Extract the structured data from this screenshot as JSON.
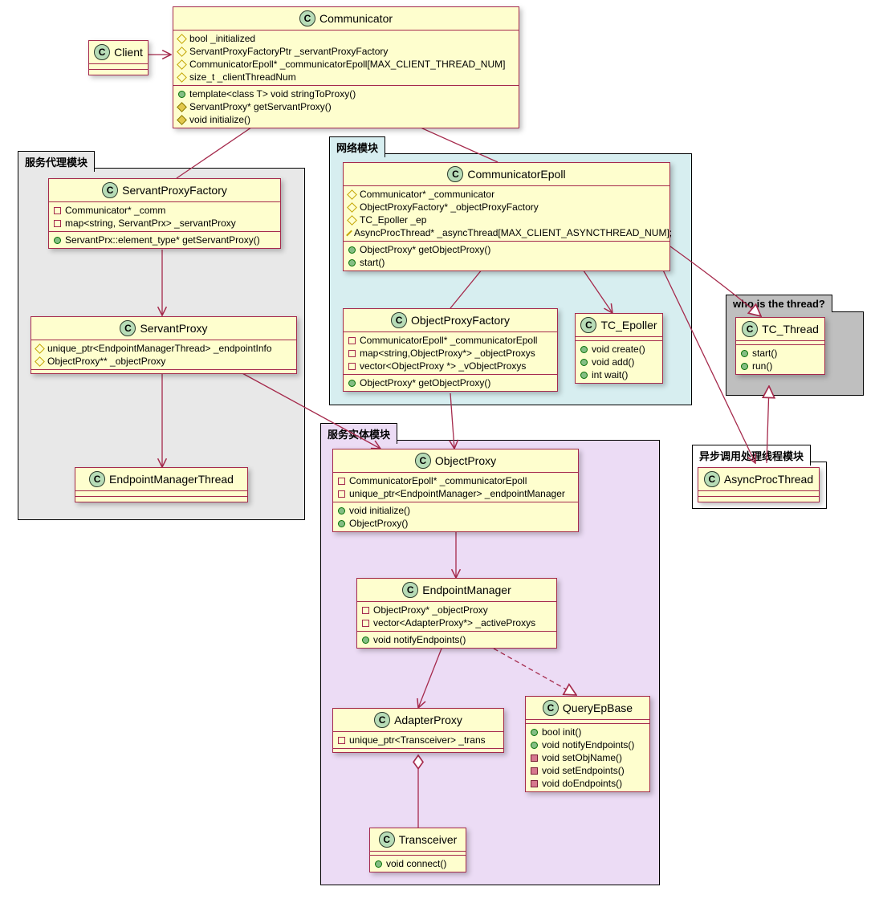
{
  "packages": {
    "proxy": {
      "title": "服务代理模块"
    },
    "net": {
      "title": "网络模块"
    },
    "entity": {
      "title": "服务实体模块"
    },
    "thread": {
      "title": "who is the thread?"
    },
    "async": {
      "title": "异步调用处理线程模块"
    }
  },
  "classes": {
    "Client": {
      "name": "Client"
    },
    "Communicator": {
      "name": "Communicator",
      "fields": [
        {
          "vis": "prot-o",
          "text": "bool _initialized"
        },
        {
          "vis": "prot-o",
          "text": "ServantProxyFactoryPtr _servantProxyFactory"
        },
        {
          "vis": "prot-o",
          "text": "CommunicatorEpoll* _communicatorEpoll[MAX_CLIENT_THREAD_NUM]"
        },
        {
          "vis": "prot-o",
          "text": "size_t _clientThreadNum"
        }
      ],
      "methods": [
        {
          "vis": "pub",
          "text": "template<class T> void stringToProxy()"
        },
        {
          "vis": "prot-f",
          "text": "ServantProxy* getServantProxy()"
        },
        {
          "vis": "prot-f",
          "text": "void initialize()"
        }
      ]
    },
    "ServantProxyFactory": {
      "name": "ServantProxyFactory",
      "fields": [
        {
          "vis": "priv-o",
          "text": "Communicator* _comm"
        },
        {
          "vis": "priv-o",
          "text": "map<string, ServantPrx> _servantProxy"
        }
      ],
      "methods": [
        {
          "vis": "pub",
          "text": "ServantPrx::element_type* getServantProxy()"
        }
      ]
    },
    "ServantProxy": {
      "name": "ServantProxy",
      "fields": [
        {
          "vis": "prot-o",
          "text": "unique_ptr<EndpointManagerThread> _endpointInfo"
        },
        {
          "vis": "prot-o",
          "text": "ObjectProxy** _objectProxy"
        }
      ]
    },
    "EndpointManagerThread": {
      "name": "EndpointManagerThread"
    },
    "CommunicatorEpoll": {
      "name": "CommunicatorEpoll",
      "fields": [
        {
          "vis": "prot-o",
          "text": "Communicator* _communicator"
        },
        {
          "vis": "prot-o",
          "text": "ObjectProxyFactory* _objectProxyFactory"
        },
        {
          "vis": "prot-o",
          "text": "TC_Epoller _ep"
        },
        {
          "vis": "prot-o",
          "text": "AsyncProcThread* _asyncThread[MAX_CLIENT_ASYNCTHREAD_NUM];"
        }
      ],
      "methods": [
        {
          "vis": "pub",
          "text": "ObjectProxy* getObjectProxy()"
        },
        {
          "vis": "pub",
          "text": "start()"
        }
      ]
    },
    "ObjectProxyFactory": {
      "name": "ObjectProxyFactory",
      "fields": [
        {
          "vis": "priv-o",
          "text": "CommunicatorEpoll* _communicatorEpoll"
        },
        {
          "vis": "priv-o",
          "text": "map<string,ObjectProxy*> _objectProxys"
        },
        {
          "vis": "priv-o",
          "text": "vector<ObjectProxy *> _vObjectProxys"
        }
      ],
      "methods": [
        {
          "vis": "pub",
          "text": "ObjectProxy* getObjectProxy()"
        }
      ]
    },
    "TC_Epoller": {
      "name": "TC_Epoller",
      "methods": [
        {
          "vis": "pub",
          "text": "void create()"
        },
        {
          "vis": "pub",
          "text": "void add()"
        },
        {
          "vis": "pub",
          "text": "int wait()"
        }
      ]
    },
    "TC_Thread": {
      "name": "TC_Thread",
      "methods": [
        {
          "vis": "pub",
          "text": "start()"
        },
        {
          "vis": "pub",
          "text": "run()"
        }
      ]
    },
    "AsyncProcThread": {
      "name": "AsyncProcThread"
    },
    "ObjectProxy": {
      "name": "ObjectProxy",
      "fields": [
        {
          "vis": "priv-o",
          "text": "CommunicatorEpoll* _communicatorEpoll"
        },
        {
          "vis": "priv-o",
          "text": "unique_ptr<EndpointManager> _endpointManager"
        }
      ],
      "methods": [
        {
          "vis": "pub",
          "text": "void initialize()"
        },
        {
          "vis": "pub",
          "text": "ObjectProxy()"
        }
      ]
    },
    "EndpointManager": {
      "name": "EndpointManager",
      "fields": [
        {
          "vis": "priv-o",
          "text": "ObjectProxy* _objectProxy"
        },
        {
          "vis": "priv-o",
          "text": "vector<AdapterProxy*> _activeProxys"
        }
      ],
      "methods": [
        {
          "vis": "pub",
          "text": "void notifyEndpoints()"
        }
      ]
    },
    "QueryEpBase": {
      "name": "QueryEpBase",
      "methods": [
        {
          "vis": "pub",
          "text": "bool init()"
        },
        {
          "vis": "pub",
          "text": "void notifyEndpoints()"
        },
        {
          "vis": "priv-f",
          "text": "void setObjName()"
        },
        {
          "vis": "priv-f",
          "text": "void setEndpoints()"
        },
        {
          "vis": "priv-f",
          "text": "void doEndpoints()"
        }
      ]
    },
    "AdapterProxy": {
      "name": "AdapterProxy",
      "fields": [
        {
          "vis": "priv-o",
          "text": "unique_ptr<Transceiver> _trans"
        }
      ]
    },
    "Transceiver": {
      "name": "Transceiver",
      "methods": [
        {
          "vis": "pub",
          "text": "void connect()"
        }
      ]
    }
  },
  "chart_data": {
    "type": "uml-class-diagram",
    "packages": [
      {
        "name": "服务代理模块",
        "classes": [
          "ServantProxyFactory",
          "ServantProxy",
          "EndpointManagerThread"
        ]
      },
      {
        "name": "网络模块",
        "classes": [
          "CommunicatorEpoll",
          "ObjectProxyFactory",
          "TC_Epoller"
        ]
      },
      {
        "name": "服务实体模块",
        "classes": [
          "ObjectProxy",
          "EndpointManager",
          "AdapterProxy",
          "QueryEpBase",
          "Transceiver"
        ]
      },
      {
        "name": "who is the thread?",
        "classes": [
          "TC_Thread"
        ]
      },
      {
        "name": "异步调用处理线程模块",
        "classes": [
          "AsyncProcThread"
        ]
      }
    ],
    "relations": [
      {
        "from": "Client",
        "to": "Communicator",
        "type": "association-arrow"
      },
      {
        "from": "Communicator",
        "to": "ServantProxyFactory",
        "type": "aggregation"
      },
      {
        "from": "Communicator",
        "to": "CommunicatorEpoll",
        "type": "aggregation"
      },
      {
        "from": "ServantProxyFactory",
        "to": "ServantProxy",
        "type": "association-arrow"
      },
      {
        "from": "ServantProxy",
        "to": "EndpointManagerThread",
        "type": "association-arrow"
      },
      {
        "from": "ServantProxy",
        "to": "ObjectProxy",
        "type": "association-arrow"
      },
      {
        "from": "CommunicatorEpoll",
        "to": "ObjectProxyFactory",
        "type": "aggregation"
      },
      {
        "from": "CommunicatorEpoll",
        "to": "TC_Epoller",
        "type": "association-arrow"
      },
      {
        "from": "CommunicatorEpoll",
        "to": "AsyncProcThread",
        "type": "association-arrow"
      },
      {
        "from": "CommunicatorEpoll",
        "to": "TC_Thread",
        "type": "generalization"
      },
      {
        "from": "ObjectProxyFactory",
        "to": "ObjectProxy",
        "type": "association-arrow"
      },
      {
        "from": "ObjectProxy",
        "to": "EndpointManager",
        "type": "association-arrow-both"
      },
      {
        "from": "EndpointManager",
        "to": "AdapterProxy",
        "type": "association-arrow"
      },
      {
        "from": "EndpointManager",
        "to": "QueryEpBase",
        "type": "realization"
      },
      {
        "from": "AdapterProxy",
        "to": "Transceiver",
        "type": "aggregation"
      },
      {
        "from": "AsyncProcThread",
        "to": "TC_Thread",
        "type": "generalization"
      }
    ]
  }
}
